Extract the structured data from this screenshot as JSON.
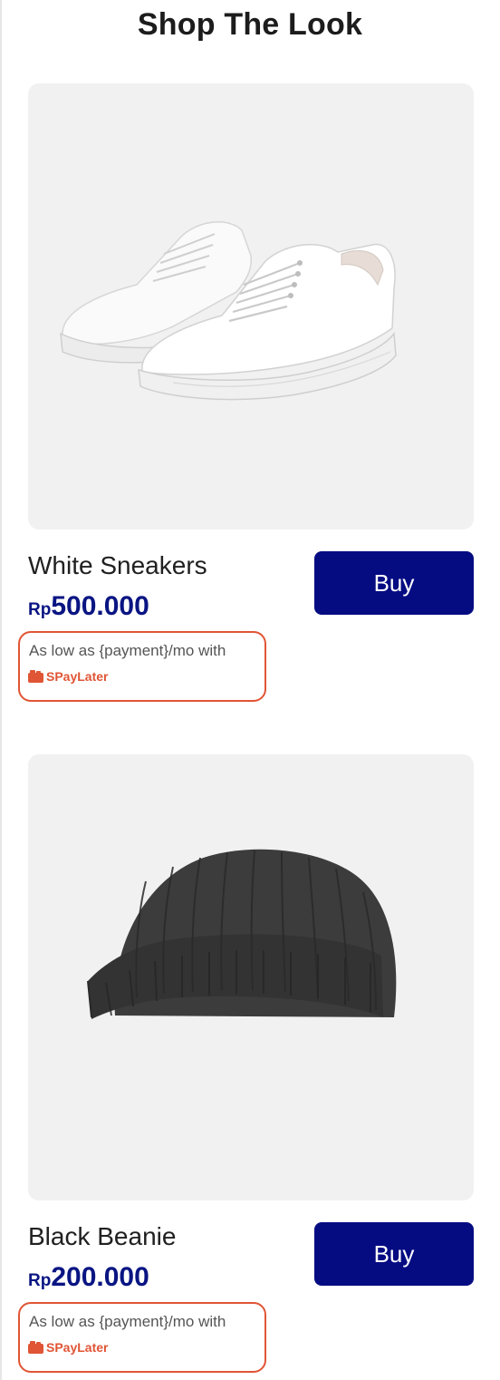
{
  "page": {
    "title": "Shop The Look"
  },
  "products": [
    {
      "name": "White Sneakers",
      "price_currency": "Rp",
      "price_amount": "500.000",
      "buy_label": "Buy",
      "paylater_text": "As low as {payment}/mo with",
      "paylater_brand": "SPayLater",
      "image_icon": "white-sneakers"
    },
    {
      "name": "Black Beanie",
      "price_currency": "Rp",
      "price_amount": "200.000",
      "buy_label": "Buy",
      "paylater_text": "As low as {payment}/mo with",
      "paylater_brand": "SPayLater",
      "image_icon": "black-beanie"
    }
  ],
  "colors": {
    "accent": "#050c82",
    "price": "#0a1583",
    "paylater": "#e05535",
    "image_bg": "#f1f1f1"
  }
}
